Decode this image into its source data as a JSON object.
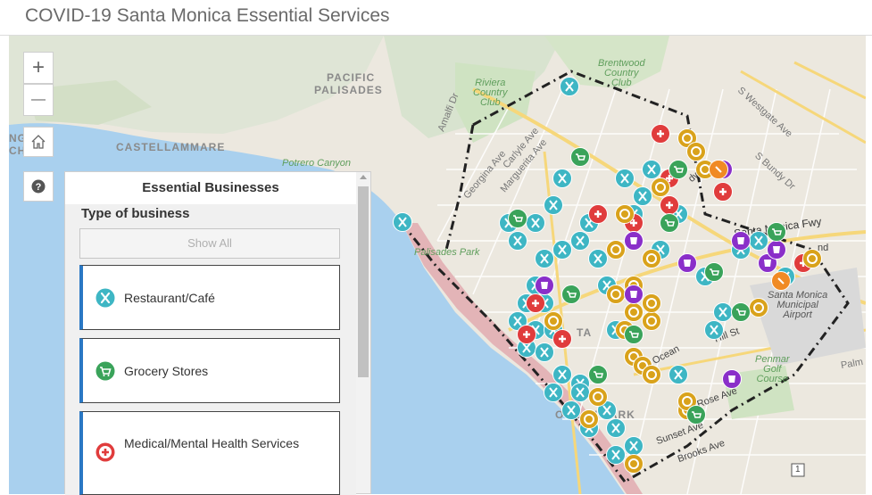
{
  "app": {
    "title": "COVID-19 Santa Monica Essential Services"
  },
  "map_controls": {
    "zoom_in": "+",
    "zoom_out": "—",
    "home_icon": "home-icon",
    "help_icon": "help-icon",
    "help_label": "?"
  },
  "map_labels": {
    "pacific": "PACIFIC",
    "palisades": "PALISADES",
    "castellammare": "CASTELLAMMARE",
    "ng": "NG",
    "ch": "CH",
    "potrero_canyon": "Potrero Canyon",
    "riviera": [
      "Riviera",
      "Country",
      "Club"
    ],
    "brentwood": [
      "Brentwood",
      "Country",
      "Club"
    ],
    "amalfi_dr": "Amalfi Dr",
    "georgina_ave": "Georgina Ave",
    "carlyle_ave": "Carlyle Ave",
    "marguerita_ave": "Marguerita Ave",
    "palisades_park": "Palisades Park",
    "westgate_ave": "S Westgate Ave",
    "bundy_dr": "S Bundy Dr",
    "santa_monica_fwy": "Santa Monica Fwy",
    "sm_airport": [
      "Santa Monica",
      "Municipal",
      "Airport"
    ],
    "penmar": [
      "Penmar",
      "Golf",
      "Course"
    ],
    "ocean_park_label": "OCEAN PARK",
    "hill_st": "Hill St",
    "rose_ave": "Rose Ave",
    "sunset_ave": "Sunset Ave",
    "brooks_ave": "Brooks Ave",
    "ocean_ave": "Ocean",
    "palms": "Palm",
    "way": "dway",
    "nd": "nd",
    "ta": "TA",
    "route_1": "1"
  },
  "panel": {
    "title": "Essential Businesses",
    "filter_heading": "Type of business",
    "show_all": "Show All",
    "categories": [
      {
        "label": "Restaurant/Café",
        "icon": "restaurant-icon",
        "color": "#3eb6c4"
      },
      {
        "label": "Grocery Stores",
        "icon": "grocery-cart-icon",
        "color": "#3aa35a"
      },
      {
        "label": "Medical/Mental Health Services",
        "icon": "medical-cross-icon",
        "color": "#e03c3c"
      }
    ]
  },
  "colors": {
    "restaurant": "#3eb6c4",
    "grocery": "#3aa35a",
    "medical": "#e03c3c",
    "bank": "#d9a21b",
    "pharmacy": "#8a2fc9",
    "other": "#f08a24",
    "accent": "#2a78c4",
    "water": "#a9d0ee"
  }
}
